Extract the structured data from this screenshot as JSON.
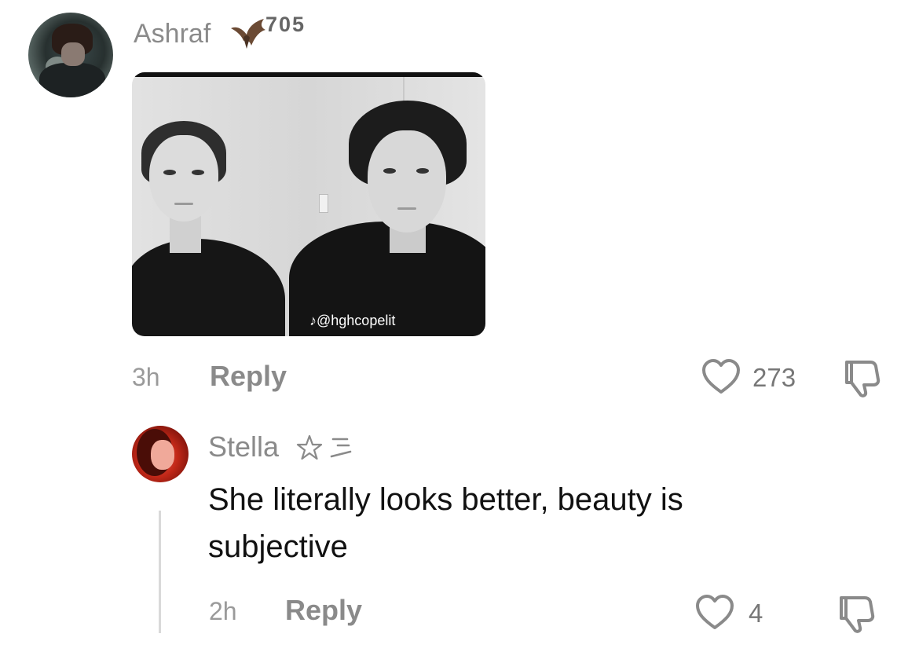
{
  "top_comment": {
    "username": "Ashraf",
    "badge_icon": "bat-icon",
    "badge_number": "705",
    "image": {
      "watermark_handle": "@hghcopelit",
      "watermark_icon": "tiktok-icon"
    },
    "time": "3h",
    "reply_label": "Reply",
    "likes": "273"
  },
  "reply_comment": {
    "username": "Stella",
    "decorations": [
      "star-icon",
      "lines-icon"
    ],
    "text": "She literally looks better, beauty is subjective",
    "time": "2h",
    "reply_label": "Reply",
    "likes": "4"
  }
}
